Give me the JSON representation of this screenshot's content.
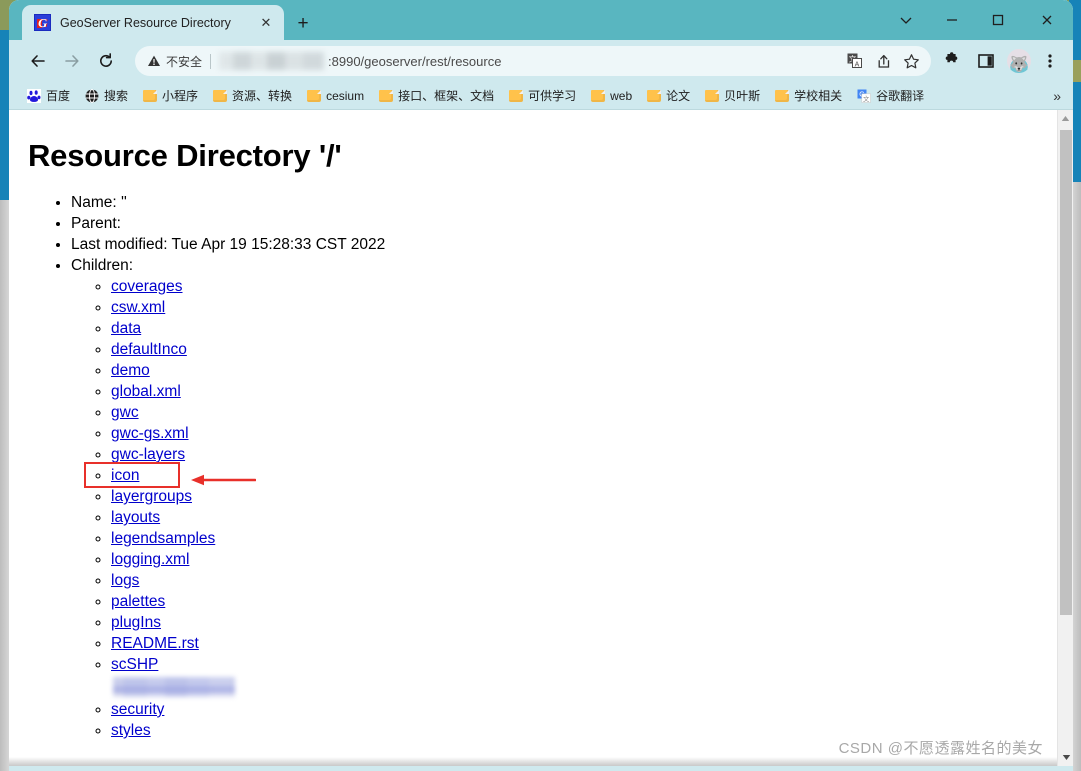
{
  "window": {
    "controls": {
      "tab_search": "tab-search",
      "minimize": "minimize",
      "maximize": "maximize",
      "close": "close"
    }
  },
  "tab": {
    "title": "GeoServer Resource Directory",
    "close_label": "✕",
    "newtab_label": "+",
    "favicon_letter": "G"
  },
  "toolbar": {
    "back": "←",
    "forward": "→",
    "reload": "⟳",
    "security_label": "不安全",
    "url": ":8990/geoserver/rest/resource",
    "icons": {
      "translate": "translate-icon",
      "share": "share-icon",
      "bookmark": "star-icon",
      "extensions": "puzzle-icon",
      "side_panel": "side-panel-icon",
      "profile": "avatar",
      "menu": "three-dot-menu"
    }
  },
  "bookmarks": {
    "items": [
      {
        "label": "百度",
        "icon": "baidu-icon"
      },
      {
        "label": "搜索",
        "icon": "globe-icon"
      },
      {
        "label": "小程序",
        "icon": "folder-icon"
      },
      {
        "label": "资源、转换",
        "icon": "folder-icon"
      },
      {
        "label": "cesium",
        "icon": "folder-icon"
      },
      {
        "label": "接口、框架、文档",
        "icon": "folder-icon"
      },
      {
        "label": "可供学习",
        "icon": "folder-icon"
      },
      {
        "label": "web",
        "icon": "folder-icon"
      },
      {
        "label": "论文",
        "icon": "folder-icon"
      },
      {
        "label": "贝叶斯",
        "icon": "folder-icon"
      },
      {
        "label": "学校相关",
        "icon": "folder-icon"
      },
      {
        "label": "谷歌翻译",
        "icon": "google-translate-icon"
      }
    ],
    "overflow": "»"
  },
  "page": {
    "title": "Resource Directory '/'",
    "info": [
      "Name: ''",
      "Parent:",
      "Last modified: Tue Apr 19 15:28:33 CST 2022",
      "Children:"
    ],
    "children": [
      {
        "label": "coverages",
        "type": "link"
      },
      {
        "label": "csw.xml",
        "type": "link"
      },
      {
        "label": "data",
        "type": "link"
      },
      {
        "label": "defaultInco",
        "type": "link"
      },
      {
        "label": "demo",
        "type": "link"
      },
      {
        "label": "global.xml",
        "type": "link"
      },
      {
        "label": "gwc",
        "type": "link"
      },
      {
        "label": "gwc-gs.xml",
        "type": "link"
      },
      {
        "label": "gwc-layers",
        "type": "link"
      },
      {
        "label": "icon",
        "type": "link",
        "highlighted": true
      },
      {
        "label": "layergroups",
        "type": "link"
      },
      {
        "label": "layouts",
        "type": "link"
      },
      {
        "label": "legendsamples",
        "type": "link"
      },
      {
        "label": "logging.xml",
        "type": "link"
      },
      {
        "label": "logs",
        "type": "link"
      },
      {
        "label": "palettes",
        "type": "link"
      },
      {
        "label": "plugIns",
        "type": "link"
      },
      {
        "label": "README.rst",
        "type": "link"
      },
      {
        "label": "scSHP",
        "type": "link"
      },
      {
        "label": "",
        "type": "blurred"
      },
      {
        "label": "security",
        "type": "link"
      },
      {
        "label": "styles",
        "type": "link"
      }
    ]
  },
  "annotation": {
    "highlight_color": "#e8302a",
    "target": "icon"
  },
  "watermark": "CSDN @不愿透露姓名的美女",
  "colors": {
    "tabstrip": "#59b6c0",
    "toolbar": "#cfe9ee",
    "link": "#0000cc",
    "accent_red": "#e8302a"
  }
}
